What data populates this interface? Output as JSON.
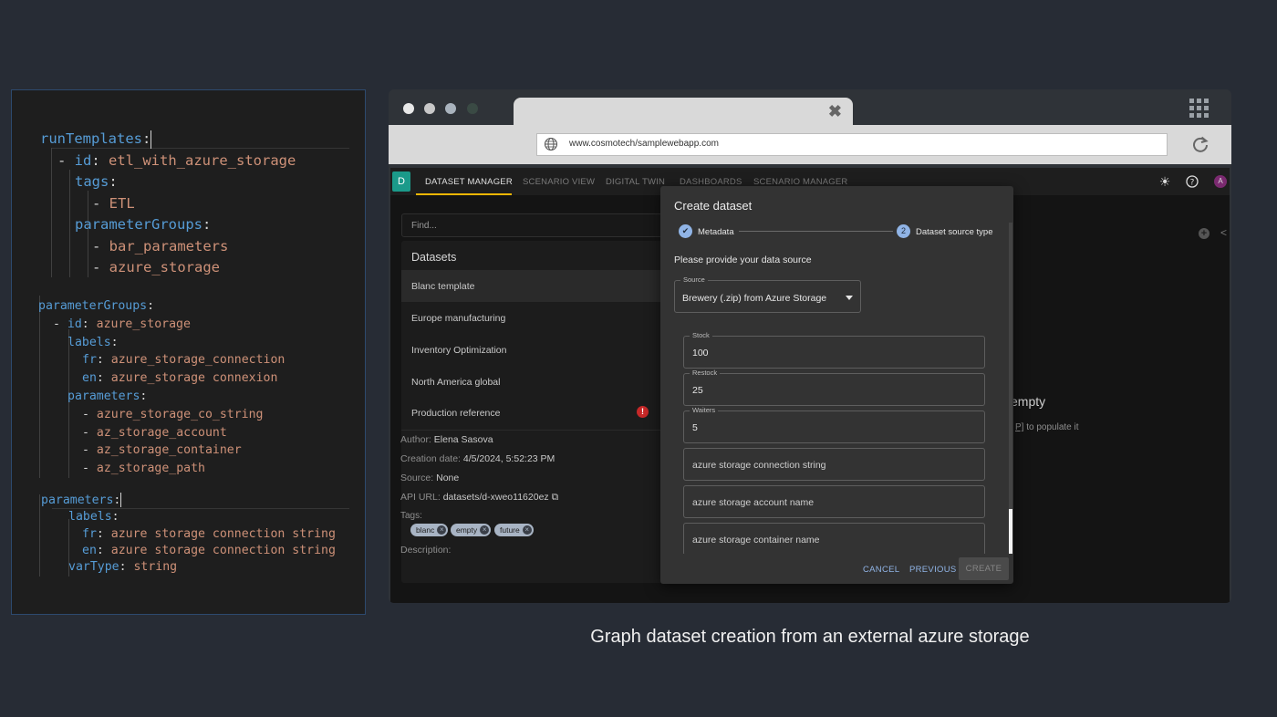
{
  "code": {
    "block1": [
      {
        "k": "runTemplates",
        "p": ":",
        "v": ""
      },
      {
        "k": "id",
        "p": ": ",
        "v": "etl_with_azure_storage",
        "dash": true
      },
      {
        "k": "tags",
        "p": ":",
        "v": ""
      },
      {
        "k": "",
        "p": "",
        "v": "ETL",
        "dash": true
      },
      {
        "k": "parameterGroups",
        "p": ":",
        "v": ""
      },
      {
        "k": "",
        "p": "",
        "v": "bar_parameters",
        "dash": true
      },
      {
        "k": "",
        "p": "",
        "v": "azure_storage",
        "dash": true
      }
    ],
    "block2": [
      {
        "k": "parameterGroups",
        "p": ":",
        "v": ""
      },
      {
        "k": "id",
        "p": ": ",
        "v": "azure_storage",
        "dash": true
      },
      {
        "k": "labels",
        "p": ":",
        "v": ""
      },
      {
        "k": "fr",
        "p": ": ",
        "v": "azure_storage_connection"
      },
      {
        "k": "en",
        "p": ": ",
        "v": "azure_storage connexion"
      },
      {
        "k": "parameters",
        "p": ":",
        "v": ""
      },
      {
        "k": "",
        "p": "",
        "v": "azure_storage_co_string",
        "dash": true
      },
      {
        "k": "",
        "p": "",
        "v": "az_storage_account",
        "dash": true
      },
      {
        "k": "",
        "p": "",
        "v": "az_storage_container",
        "dash": true
      },
      {
        "k": "",
        "p": "",
        "v": "az_storage_path",
        "dash": true
      }
    ],
    "block3": [
      {
        "k": "parameters",
        "p": ":",
        "v": ""
      },
      {
        "k": "labels",
        "p": ":",
        "v": ""
      },
      {
        "k": "fr",
        "p": ": ",
        "v": "azure storage connection string"
      },
      {
        "k": "en",
        "p": ": ",
        "v": "azure storage connection string"
      },
      {
        "k": "varType",
        "p": ": ",
        "v": "string"
      }
    ]
  },
  "browser": {
    "url": "www.cosmotech/samplewebapp.com",
    "dot_colors": [
      "#e8e8e8",
      "#c8c8c8",
      "#a9b3bd",
      "#3a4a44"
    ]
  },
  "app": {
    "logo_letter": "D",
    "nav_tabs": [
      "DATASET MANAGER",
      "SCENARIO VIEW",
      "DIGITAL TWIN",
      "DASHBOARDS",
      "SCENARIO MANAGER"
    ],
    "avatar_letter": "A",
    "search_placeholder": "Find...",
    "datasets_title": "Datasets",
    "datasets": [
      "Blanc template",
      "Europe manufacturing",
      "Inventory Optimization",
      "North America global",
      "Production reference"
    ],
    "error_mark": "!",
    "details": {
      "author_label": "Author:",
      "author": "Elena Sasova",
      "creation_label": "Creation date:",
      "creation": "4/5/2024, 5:52:23 PM",
      "source_label": "Source:",
      "source": "None",
      "api_label": "API URL:",
      "api": "datasets/d-xweo11620ez",
      "tags_label": "Tags:",
      "tags": [
        "blanc",
        "empty",
        "future"
      ],
      "description_label": "Description:"
    },
    "background_empty": "empty",
    "background_populate_prefix": "P]",
    "background_populate": "to populate it"
  },
  "dialog": {
    "title": "Create dataset",
    "step1": "Metadata",
    "step2_number": "2",
    "step2": "Dataset source type",
    "prompt": "Please provide your data source",
    "source_label": "Source",
    "source_value": "Brewery (.zip) from Azure Storage",
    "fields": [
      {
        "label": "Stock",
        "value": "100"
      },
      {
        "label": "Restock",
        "value": "25"
      },
      {
        "label": "Waiters",
        "value": "5"
      }
    ],
    "placeholders": [
      "azure storage connection string",
      "azure storage account name",
      "azure storage container name"
    ],
    "cancel": "CANCEL",
    "previous": "PREVIOUS",
    "create": "CREATE"
  },
  "caption": "Graph dataset creation from an external azure storage"
}
